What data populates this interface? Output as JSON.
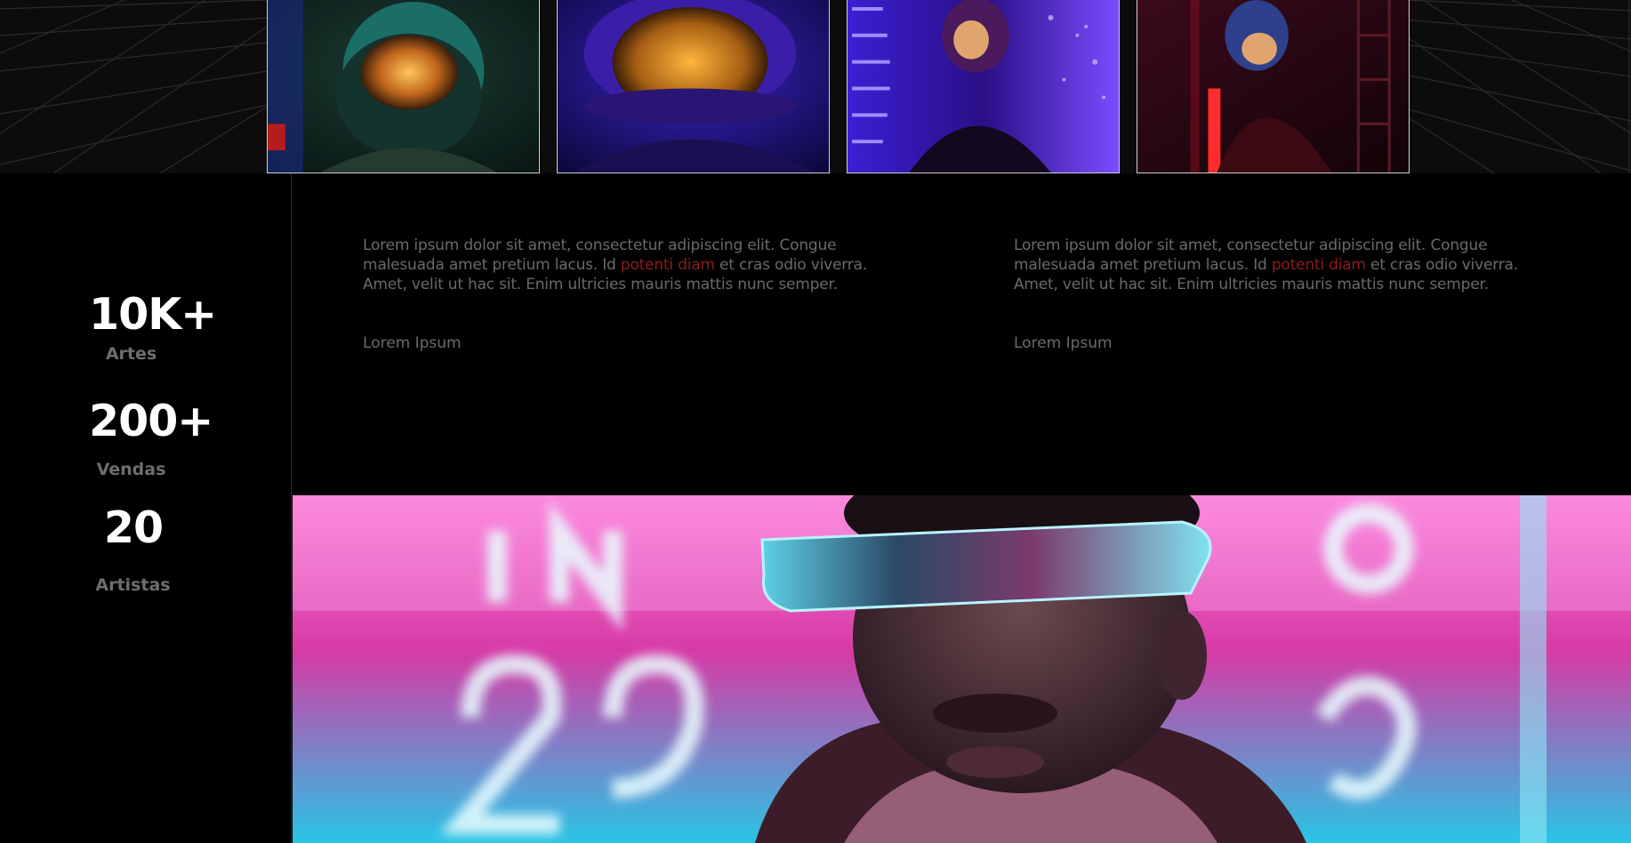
{
  "gallery": {
    "images": [
      {
        "alt": "astronaut-helmet-green"
      },
      {
        "alt": "astronaut-helmet-gold"
      },
      {
        "alt": "astronaut-helmet-violet"
      },
      {
        "alt": "astronaut-helmet-red"
      }
    ]
  },
  "stats": [
    {
      "value": "10K+",
      "label": "Artes"
    },
    {
      "value": "200+",
      "label": "Vendas"
    },
    {
      "value": "20",
      "label": "Artistas"
    }
  ],
  "columns": [
    {
      "text_before": "Lorem ipsum dolor sit amet, consectetur adipiscing elit. Congue malesuada amet pretium lacus. Id ",
      "accent": "potenti diam",
      "text_after": " et cras odio viverra. Amet, velit ut hac sit. Enim ultricies mauris mattis nunc semper.",
      "byline": "Lorem Ipsum"
    },
    {
      "text_before": "Lorem ipsum dolor sit amet, consectetur adipiscing elit. Congue malesuada amet pretium lacus. Id ",
      "accent": "potenti diam",
      "text_after": " et cras odio viverra. Amet, velit ut hac sit. Enim ultricies mauris mattis nunc semper.",
      "byline": "Lorem Ipsum"
    }
  ],
  "hero": {
    "alt": "neon-portrait-visor"
  },
  "colors": {
    "accent": "#8e1b1b",
    "muted": "#6a6a6a",
    "background": "#000000"
  }
}
